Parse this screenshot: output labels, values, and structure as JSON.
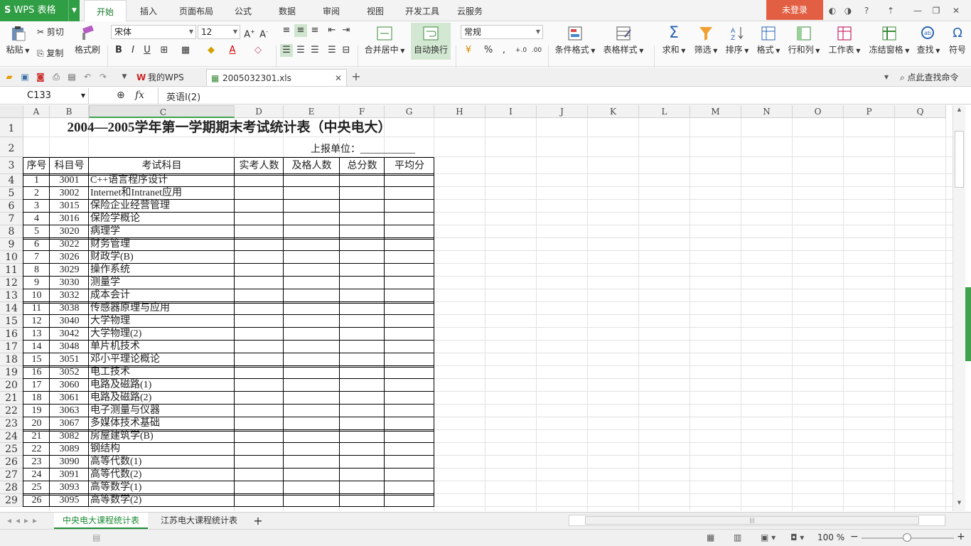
{
  "menubar": {
    "app_name": "WPS 表格",
    "tabs": [
      "开始",
      "插入",
      "页面布局",
      "公式",
      "数据",
      "审阅",
      "视图",
      "开发工具",
      "云服务"
    ],
    "login": "未登录"
  },
  "ribbon": {
    "paste": "粘贴",
    "cut": "剪切",
    "copy": "复制",
    "format_painter": "格式刷",
    "font_name": "宋体",
    "font_size": "12",
    "merge_center": "合并居中",
    "wrap_text": "自动换行",
    "number_format": "常规",
    "cond_format": "条件格式",
    "table_style": "表格样式",
    "sum": "求和",
    "filter": "筛选",
    "sort": "排序",
    "format": "格式",
    "rows_cols": "行和列",
    "worksheet": "工作表",
    "freeze": "冻结窗格",
    "find": "查找",
    "symbol": "符号"
  },
  "quickbar": {
    "tabs": [
      "我的WPS",
      "2005032301.xls"
    ],
    "search_cmd": "点此查找命令"
  },
  "formula_bar": {
    "name_box": "C133",
    "fx": "fx",
    "content": "英语Ⅰ(2)"
  },
  "columns": [
    "A",
    "B",
    "C",
    "D",
    "E",
    "F",
    "G",
    "H",
    "I",
    "J",
    "K",
    "L",
    "M",
    "N",
    "O",
    "P",
    "Q"
  ],
  "rows": [
    "1",
    "2",
    "3",
    "4",
    "5",
    "6",
    "7",
    "8",
    "9",
    "10",
    "11",
    "12",
    "13",
    "14",
    "15",
    "16",
    "17",
    "18",
    "19",
    "20",
    "21",
    "22",
    "23",
    "24",
    "25",
    "26",
    "27",
    "28",
    "29"
  ],
  "sheet": {
    "title": "2004—2005学年第一学期期末考试统计表（中央电大）",
    "report_unit": "上报单位：___________",
    "headers": [
      "序号",
      "科目号",
      "考试科目",
      "实考人数",
      "及格人数",
      "总分数",
      "平均分"
    ],
    "data": [
      [
        "1",
        "3001",
        "C++语言程序设计"
      ],
      [
        "2",
        "3002",
        "Internet和Intranet应用"
      ],
      [
        "3",
        "3015",
        "保险企业经营管理"
      ],
      [
        "4",
        "3016",
        "保险学概论"
      ],
      [
        "5",
        "3020",
        "病理学"
      ],
      [
        "6",
        "3022",
        "财务管理"
      ],
      [
        "7",
        "3026",
        "财政学(B)"
      ],
      [
        "8",
        "3029",
        "操作系统"
      ],
      [
        "9",
        "3030",
        "测量学"
      ],
      [
        "10",
        "3032",
        "成本会计"
      ],
      [
        "11",
        "3038",
        "传感器原理与应用"
      ],
      [
        "12",
        "3040",
        "大学物理"
      ],
      [
        "13",
        "3042",
        "大学物理(2)"
      ],
      [
        "14",
        "3048",
        "单片机技术"
      ],
      [
        "15",
        "3051",
        "邓小平理论概论"
      ],
      [
        "16",
        "3052",
        "电工技术"
      ],
      [
        "17",
        "3060",
        "电路及磁路(1)"
      ],
      [
        "18",
        "3061",
        "电路及磁路(2)"
      ],
      [
        "19",
        "3063",
        "电子测量与仪器"
      ],
      [
        "20",
        "3067",
        "多媒体技术基础"
      ],
      [
        "21",
        "3082",
        "房屋建筑学(B)"
      ],
      [
        "22",
        "3089",
        "钢结构"
      ],
      [
        "23",
        "3090",
        "高等代数(1)"
      ],
      [
        "24",
        "3091",
        "高等代数(2)"
      ],
      [
        "25",
        "3093",
        "高等数学(1)"
      ],
      [
        "26",
        "3095",
        "高等数学(2)"
      ]
    ]
  },
  "sheet_tabs": [
    "中央电大课程统计表",
    "江苏电大课程统计表"
  ],
  "status": {
    "zoom": "100 %"
  }
}
